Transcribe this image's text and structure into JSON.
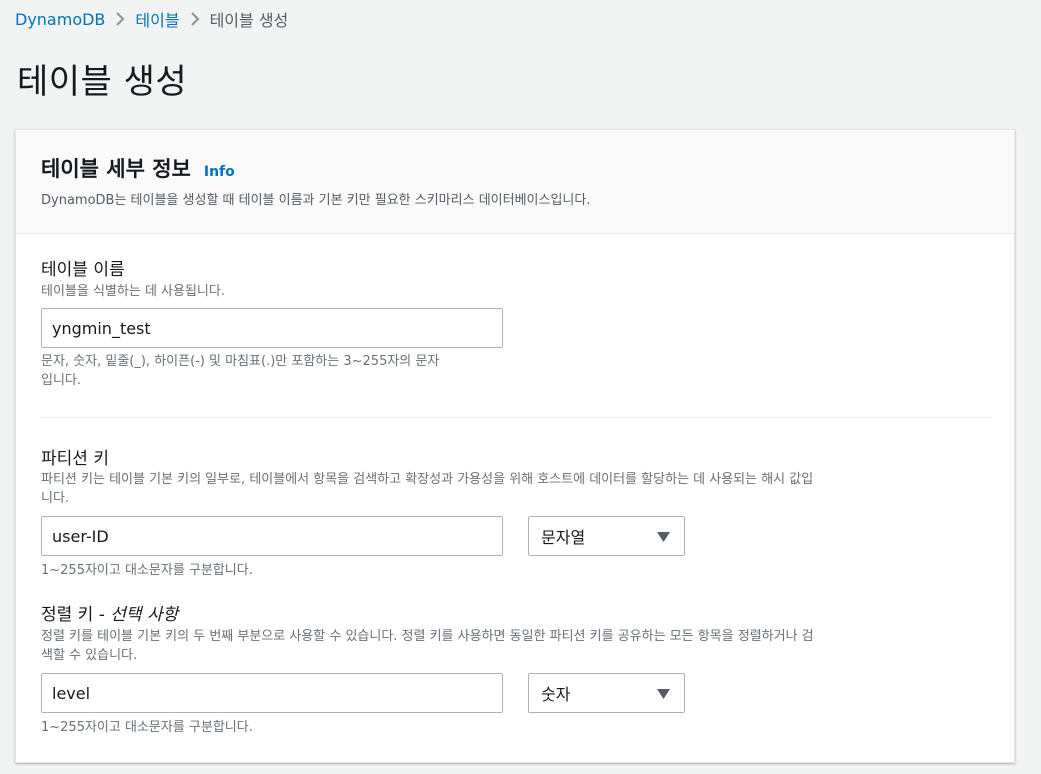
{
  "breadcrumb": {
    "items": [
      "DynamoDB",
      "테이블",
      "테이블 생성"
    ]
  },
  "page_title": "테이블 생성",
  "panel": {
    "title": "테이블 세부 정보",
    "info_link": "Info",
    "description": "DynamoDB는 테이블을 생성할 때 테이블 이름과 기본 키만 필요한 스키마리스 데이터베이스입니다."
  },
  "table_name": {
    "label": "테이블 이름",
    "description": "테이블을 식별하는 데 사용됩니다.",
    "value": "yngmin_test",
    "hint_line1": "문자, 숫자, 밑줄(_), 하이픈(-) 및 마침표(.)만 포함하는 3~255자의 문자",
    "hint_line2": "입니다."
  },
  "partition_key": {
    "label": "파티션 키",
    "description_line1": "파티션 키는 테이블 기본 키의 일부로, 테이블에서 항목을 검색하고 확장성과 가용성을 위해 호스트에 데이터를 할당하는 데 사용되는 해시 값입",
    "description_line2": "니다.",
    "value": "user-ID",
    "type": "문자열",
    "hint": "1~255자이고 대소문자를 구분합니다."
  },
  "sort_key": {
    "label": "정렬 키",
    "label_suffix": " - ",
    "optional": "선택 사항",
    "description_line1": "정렬 키를 테이블 기본 키의 두 번째 부분으로 사용할 수 있습니다. 정렬 키를 사용하면 동일한 파티션 키를 공유하는 모든 항목을 정렬하거나 검",
    "description_line2": "색할 수 있습니다.",
    "value": "level",
    "type": "숫자",
    "hint": "1~255자이고 대소문자를 구분합니다."
  },
  "colors": {
    "link": "#0073bb",
    "text": "#16191f",
    "muted": "#687078",
    "background": "#f2f3f3"
  },
  "icons": [
    "chevron-right-icon",
    "caret-down-icon"
  ]
}
